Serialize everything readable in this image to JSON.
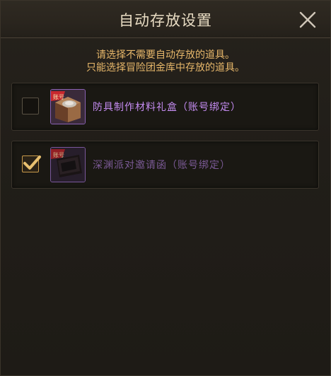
{
  "dialog": {
    "title": "自动存放设置",
    "hint_line1": "请选择不需要自动存放的道具。",
    "hint_line2": "只能选择冒险团金库中存放的道具。"
  },
  "items": [
    {
      "name": "防具制作材料礼盒（账号绑定）",
      "checked": false,
      "icon": "gift-box-icon",
      "tag": "账号"
    },
    {
      "name": "深渊派对邀请函（账号绑定）",
      "checked": true,
      "icon": "invitation-icon",
      "tag": "账号"
    }
  ],
  "colors": {
    "title": "#e8dcc3",
    "hint": "#e7b76a",
    "item_name": "#c48bf0",
    "check": "#e8c070"
  }
}
